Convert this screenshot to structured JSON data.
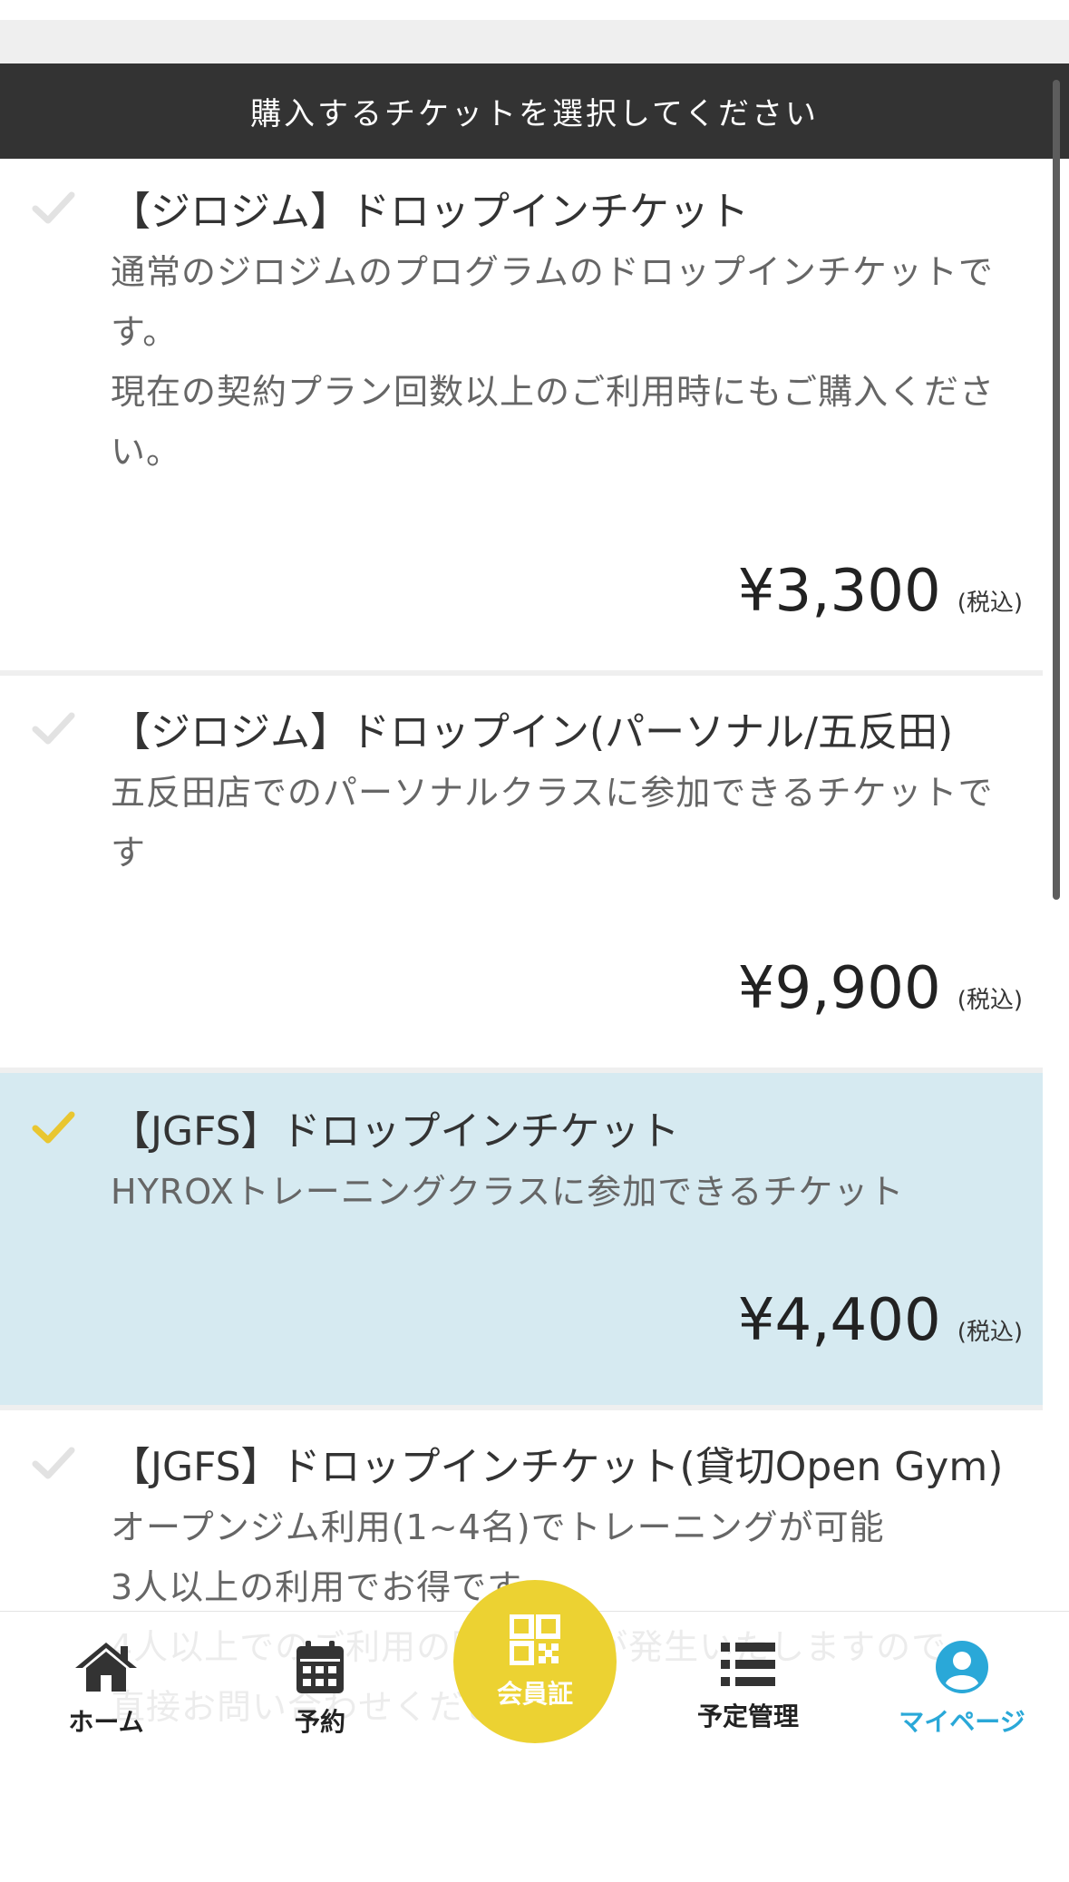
{
  "header": {
    "title": "購入するチケットを選択してください"
  },
  "tickets": [
    {
      "title": "【ジロジム】ドロップインチケット",
      "description": "通常のジロジムのプログラムのドロップインチケットです。\n現在の契約プラン回数以上のご利用時にもご購入ください。",
      "price": "¥3,300",
      "tax_note": "(税込)",
      "selected": false
    },
    {
      "title": "【ジロジム】ドロップイン(パーソナル/五反田)",
      "description": "五反田店でのパーソナルクラスに参加できるチケットです",
      "price": "¥9,900",
      "tax_note": "(税込)",
      "selected": false
    },
    {
      "title": "【JGFS】ドロップインチケット",
      "description": "HYROXトレーニングクラスに参加できるチケット",
      "price": "¥4,400",
      "tax_note": "(税込)",
      "selected": true
    },
    {
      "title": "【JGFS】ドロップインチケット(貸切Open Gym)",
      "description": "オープンジム利用(1~4名)でトレーニングが可能\n3人以上の利用でお得です\n4人以上でのご利用の際は費用が発生いたしますので\n直接お問い合わせください",
      "selected": false
    }
  ],
  "nav": {
    "home": "ホーム",
    "reserve": "予約",
    "member_card": "会員証",
    "schedule": "予定管理",
    "mypage": "マイページ"
  },
  "colors": {
    "header_bg": "#333333",
    "selected_bg": "#d6eaf1",
    "check_selected": "#e9c630",
    "check_unselected": "#e2e2e2",
    "member_button": "#ecd232",
    "nav_active": "#2aa8d8"
  }
}
